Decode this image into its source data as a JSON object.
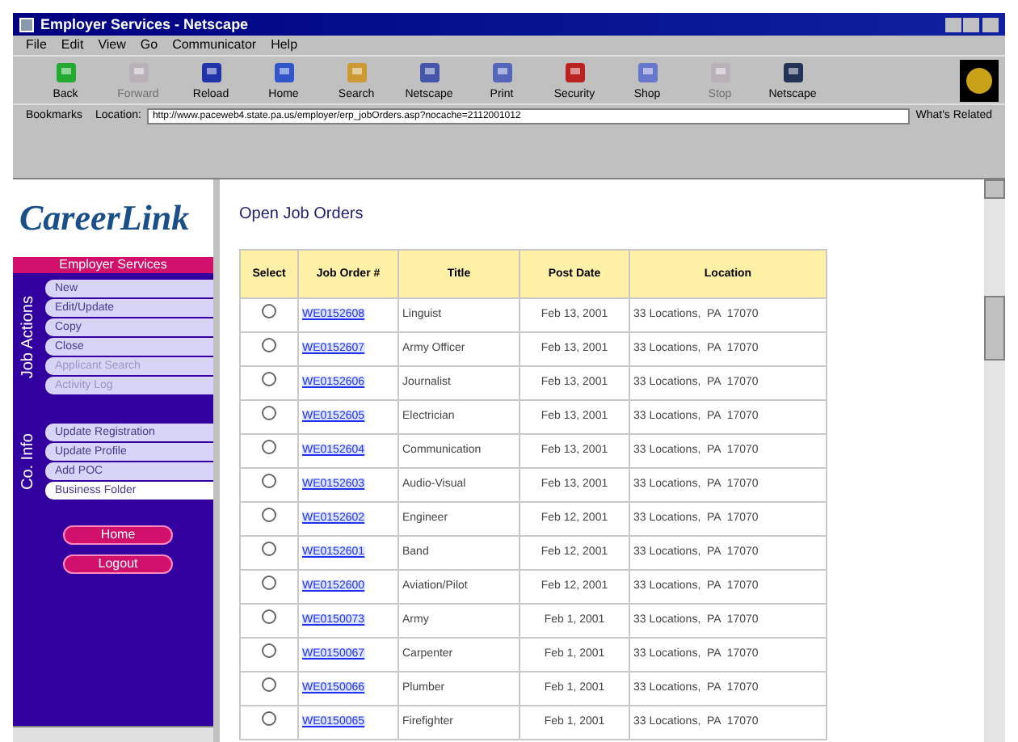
{
  "window": {
    "title": "Employer Services - Netscape"
  },
  "menu": [
    "File",
    "Edit",
    "View",
    "Go",
    "Communicator",
    "Help"
  ],
  "toolbar": [
    {
      "label": "Back",
      "disabled": false
    },
    {
      "label": "Forward",
      "disabled": true
    },
    {
      "label": "Reload",
      "disabled": false
    },
    {
      "label": "Home",
      "disabled": false
    },
    {
      "label": "Search",
      "disabled": false
    },
    {
      "label": "Netscape",
      "disabled": false
    },
    {
      "label": "Print",
      "disabled": false
    },
    {
      "label": "Security",
      "disabled": false
    },
    {
      "label": "Shop",
      "disabled": false
    },
    {
      "label": "Stop",
      "disabled": true
    },
    {
      "label": "Netscape",
      "disabled": false
    }
  ],
  "location_bar": {
    "bookmarks": "Bookmarks",
    "label": "Location:",
    "url": "http://www.paceweb4.state.pa.us/employer/erp_jobOrders.asp?nocache=2112001012",
    "related": "What's Related"
  },
  "sidebar": {
    "logo": "CareerLink",
    "header": "Employer Services",
    "groups": [
      {
        "label": "Job Actions",
        "items": [
          {
            "label": "New",
            "disabled": false,
            "selected": false
          },
          {
            "label": "Edit/Update",
            "disabled": false,
            "selected": false
          },
          {
            "label": "Copy",
            "disabled": false,
            "selected": false
          },
          {
            "label": "Close",
            "disabled": false,
            "selected": false
          },
          {
            "label": "Applicant Search",
            "disabled": true,
            "selected": false
          },
          {
            "label": "Activity Log",
            "disabled": true,
            "selected": false
          }
        ]
      },
      {
        "label": "Co. Info",
        "items": [
          {
            "label": "Update Registration",
            "disabled": false,
            "selected": false
          },
          {
            "label": "Update Profile",
            "disabled": false,
            "selected": false
          },
          {
            "label": "Add POC",
            "disabled": false,
            "selected": false
          },
          {
            "label": "Business Folder",
            "disabled": false,
            "selected": true
          }
        ]
      }
    ],
    "buttons": [
      "Home",
      "Logout"
    ]
  },
  "page": {
    "heading": "Open Job Orders",
    "table": {
      "columns": [
        "Select",
        "Job Order #",
        "Title",
        "Post Date",
        "Location"
      ],
      "rows": [
        {
          "selected": false,
          "job_order": "WE0152608",
          "title": "Linguist",
          "post_date": "Feb 13, 2001",
          "location": "33 Locations,  PA  17070"
        },
        {
          "selected": false,
          "job_order": "WE0152607",
          "title": "Army Officer",
          "post_date": "Feb 13, 2001",
          "location": "33 Locations,  PA  17070"
        },
        {
          "selected": false,
          "job_order": "WE0152606",
          "title": "Journalist",
          "post_date": "Feb 13, 2001",
          "location": "33 Locations,  PA  17070"
        },
        {
          "selected": false,
          "job_order": "WE0152605",
          "title": "Electrician",
          "post_date": "Feb 13, 2001",
          "location": "33 Locations,  PA  17070"
        },
        {
          "selected": false,
          "job_order": "WE0152604",
          "title": "Communication",
          "post_date": "Feb 13, 2001",
          "location": "33 Locations,  PA  17070"
        },
        {
          "selected": false,
          "job_order": "WE0152603",
          "title": "Audio-Visual",
          "post_date": "Feb 13, 2001",
          "location": "33 Locations,  PA  17070"
        },
        {
          "selected": false,
          "job_order": "WE0152602",
          "title": "Engineer",
          "post_date": "Feb 12, 2001",
          "location": "33 Locations,  PA  17070"
        },
        {
          "selected": false,
          "job_order": "WE0152601",
          "title": "Band",
          "post_date": "Feb 12, 2001",
          "location": "33 Locations,  PA  17070"
        },
        {
          "selected": false,
          "job_order": "WE0152600",
          "title": "Aviation/Pilot",
          "post_date": "Feb 12, 2001",
          "location": "33 Locations,  PA  17070"
        },
        {
          "selected": false,
          "job_order": "WE0150073",
          "title": "Army",
          "post_date": "Feb 1, 2001",
          "location": "33 Locations,  PA  17070"
        },
        {
          "selected": false,
          "job_order": "WE0150067",
          "title": "Carpenter",
          "post_date": "Feb 1, 2001",
          "location": "33 Locations,  PA  17070"
        },
        {
          "selected": false,
          "job_order": "WE0150066",
          "title": "Plumber",
          "post_date": "Feb 1, 2001",
          "location": "33 Locations,  PA  17070"
        },
        {
          "selected": false,
          "job_order": "WE0150065",
          "title": "Firefighter",
          "post_date": "Feb 1, 2001",
          "location": "33 Locations,  PA  17070"
        }
      ]
    }
  }
}
